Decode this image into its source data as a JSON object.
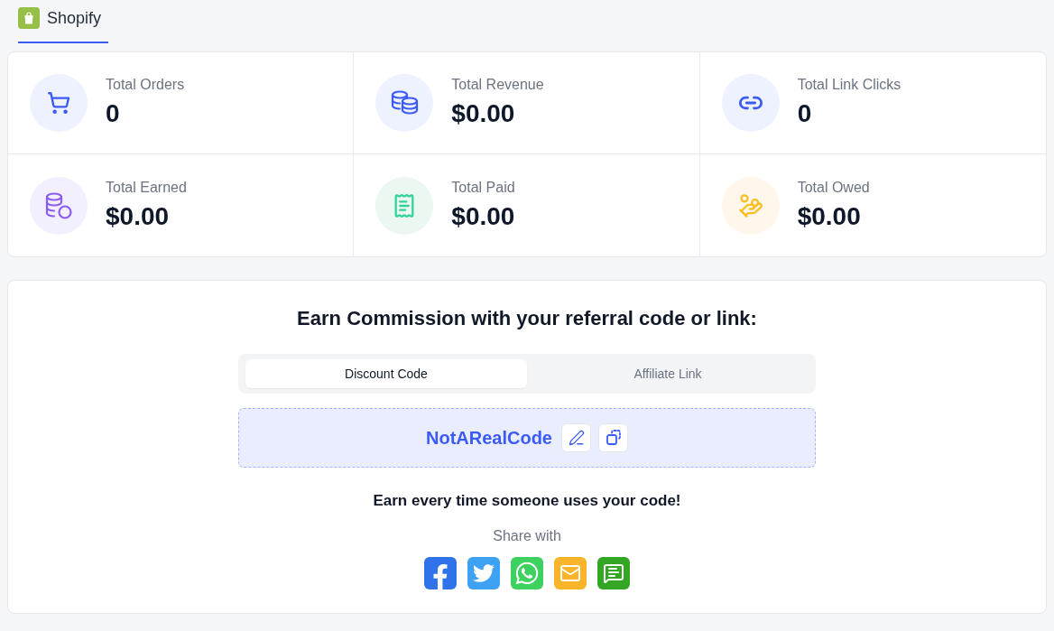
{
  "platform_tabs": [
    {
      "label": "Shopify",
      "selected": true
    }
  ],
  "stats": [
    {
      "kind": "orders",
      "label": "Total Orders",
      "value": "0"
    },
    {
      "kind": "revenue",
      "label": "Total Revenue",
      "value": "$0.00"
    },
    {
      "kind": "clicks",
      "label": "Total Link Clicks",
      "value": "0"
    },
    {
      "kind": "earned",
      "label": "Total Earned",
      "value": "$0.00"
    },
    {
      "kind": "paid",
      "label": "Total Paid",
      "value": "$0.00"
    },
    {
      "kind": "owed",
      "label": "Total Owed",
      "value": "$0.00"
    }
  ],
  "referral": {
    "title": "Earn Commission with your referral code or link:",
    "tabs": [
      {
        "label": "Discount Code",
        "selected": true
      },
      {
        "label": "Affiliate Link",
        "selected": false
      }
    ],
    "code": "NotARealCode",
    "note": "Earn every time someone uses your code!",
    "share_label": "Share with",
    "share_buttons": [
      {
        "kind": "facebook"
      },
      {
        "kind": "twitter"
      },
      {
        "kind": "whatsapp"
      },
      {
        "kind": "email"
      },
      {
        "kind": "sms"
      }
    ]
  }
}
